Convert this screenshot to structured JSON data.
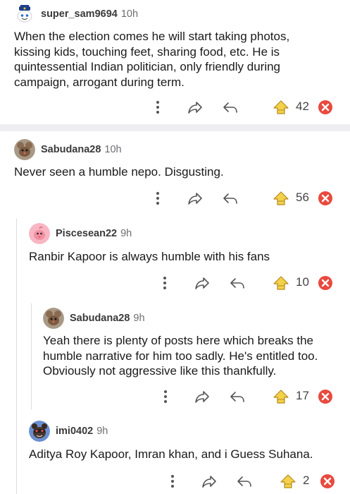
{
  "colors": {
    "downvote": "#e84a3f",
    "upvote": "#f3d24a",
    "thread": "#dcdcdc",
    "divider": "#eeeef0"
  },
  "comments": [
    {
      "username": "super_sam9694",
      "time": "10h",
      "lines": [
        "When the election comes he will start taking photos,",
        "kissing kids, touching feet, sharing food, etc. He is",
        "quintessential Indian politician, only friendly during",
        "campaign, arrogant during term."
      ],
      "score": "42",
      "avatar": "snoo-avatar-icon"
    },
    {
      "username": "Sabudana28",
      "time": "10h",
      "lines": [
        "Never seen a humble nepo. Disgusting."
      ],
      "score": "56",
      "avatar": "mouse-avatar-icon"
    },
    {
      "username": "Piscesean22",
      "time": "9h",
      "lines": [
        "Ranbir Kapoor is always humble with his fans"
      ],
      "score": "10",
      "avatar": "pink-bird-avatar-icon"
    },
    {
      "username": "Sabudana28",
      "time": "9h",
      "lines": [
        "Yeah there is plenty of posts here which breaks the",
        "humble narrative for him too sadly. He's entitled too.",
        "Obviously not aggressive like this thankfully."
      ],
      "score": "17",
      "avatar": "mouse-avatar-icon"
    },
    {
      "username": "imi0402",
      "time": "9h",
      "lines": [
        "Aditya Roy Kapoor, Imran khan,  and i Guess Suhana."
      ],
      "score": "2",
      "avatar": "bear-avatar-icon"
    }
  ]
}
